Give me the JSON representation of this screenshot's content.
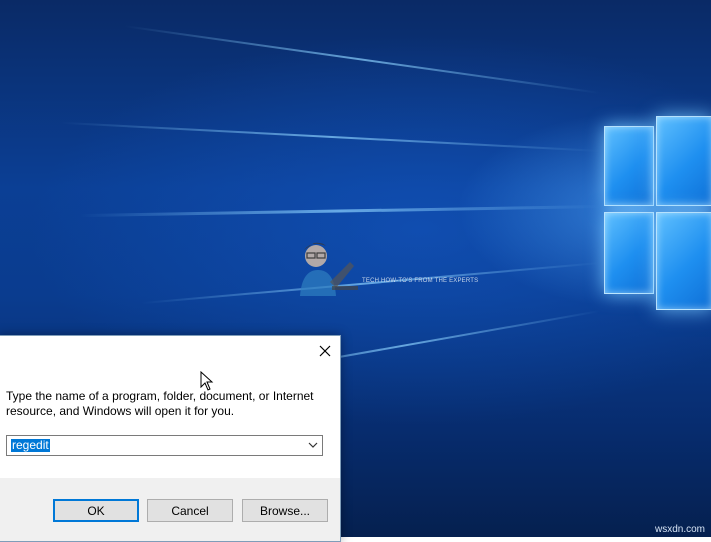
{
  "desktop": {
    "watermark_text": "TECH HOW-TO'S FROM THE EXPERTS",
    "corner_mark": "wsxdn.com"
  },
  "run_dialog": {
    "prompt": "Type the name of a program, folder, document, or Internet resource, and Windows will open it for you.",
    "open_value": "regedit",
    "buttons": {
      "ok": "OK",
      "cancel": "Cancel",
      "browse": "Browse..."
    }
  },
  "icons": {
    "close": "close-icon",
    "dropdown": "chevron-down-icon",
    "cursor": "mouse-cursor-icon"
  },
  "colors": {
    "selection": "#0078d7",
    "button_face": "#e1e1e1",
    "dialog_footer": "#f0f0f0"
  }
}
